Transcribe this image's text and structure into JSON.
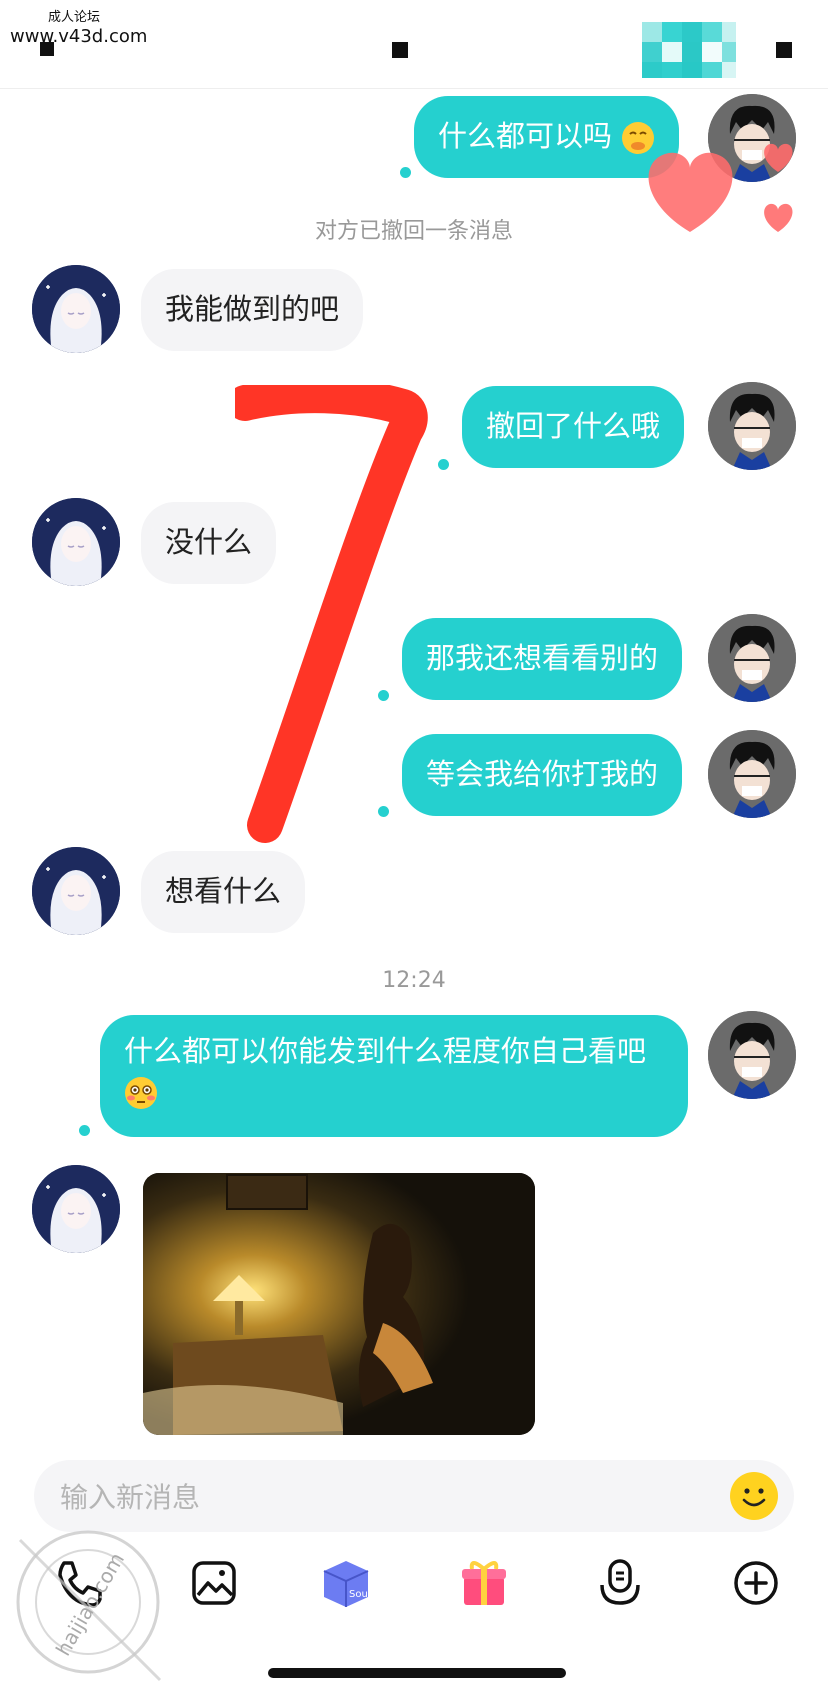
{
  "status_bar": {
    "watermark_top": "成人论坛",
    "watermark_url": "www.v43d.com"
  },
  "messages": [
    {
      "side": "me",
      "text": "什么都可以吗",
      "emoji": "shushing-face"
    },
    {
      "side": "system",
      "text": "对方已撤回一条消息"
    },
    {
      "side": "them",
      "text": "我能做到的吧"
    },
    {
      "side": "me",
      "text": "撤回了什么哦"
    },
    {
      "side": "them",
      "text": "没什么"
    },
    {
      "side": "me",
      "text": "那我还想看看别的"
    },
    {
      "side": "me",
      "text": "等会我给你打我的"
    },
    {
      "side": "them",
      "text": "想看什么"
    },
    {
      "side": "time",
      "text": "12:24"
    },
    {
      "side": "me",
      "text": "什么都可以你能发到什么程度你自己看吧",
      "emoji": "flushed-face"
    },
    {
      "side": "them",
      "type": "image",
      "content": "photo"
    }
  ],
  "input": {
    "placeholder": "输入新消息"
  },
  "toolbar": {
    "items": [
      "phone-icon",
      "image-icon",
      "soul-box-icon",
      "gift-icon",
      "voice-icon",
      "plus-icon"
    ],
    "soul_label": "Soul"
  },
  "overlay": {
    "watermark_bottom": "haijiao.com"
  },
  "colors": {
    "accent": "#25d0cf",
    "their_bubble": "#f4f4f6",
    "scribble": "#ff2a1a"
  }
}
